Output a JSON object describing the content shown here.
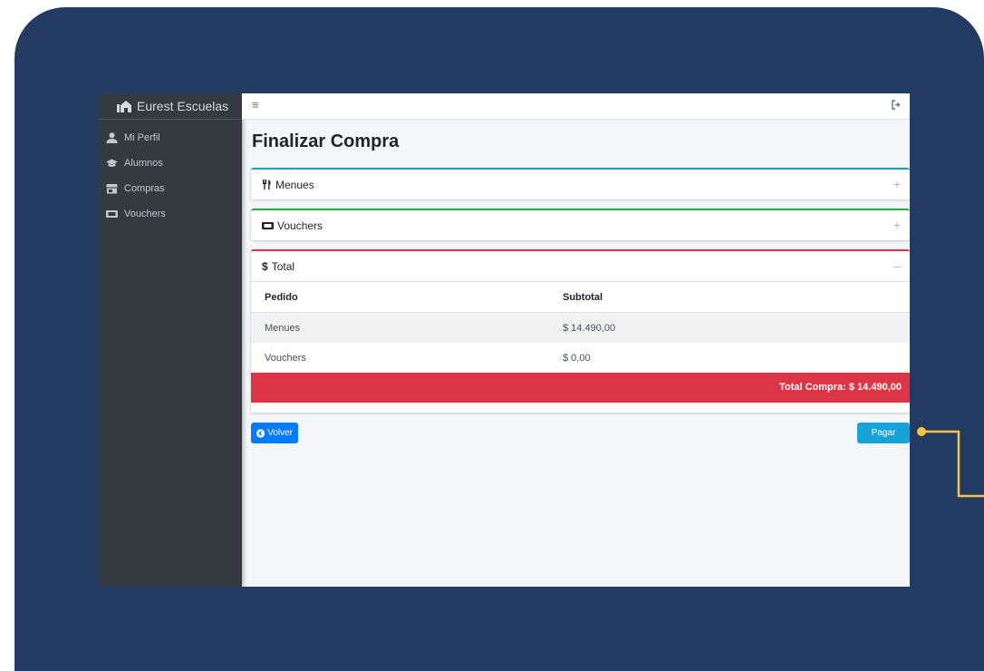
{
  "brand": {
    "name": "Eurest Escuelas"
  },
  "sidebar": {
    "items": [
      {
        "label": "Mi Perfil",
        "icon": "user-icon"
      },
      {
        "label": "Alumnos",
        "icon": "graduation-cap-icon"
      },
      {
        "label": "Compras",
        "icon": "store-icon"
      },
      {
        "label": "Vouchers",
        "icon": "ticket-icon"
      }
    ]
  },
  "topbar": {
    "menu_icon": "hamburger-icon",
    "logout_icon": "sign-out-icon"
  },
  "page": {
    "title": "Finalizar Compra"
  },
  "cards": {
    "menues": {
      "title": "Menues",
      "tool": "+"
    },
    "vouchers": {
      "title": "Vouchers",
      "tool": "+"
    },
    "total": {
      "title": "Total",
      "tool": "–",
      "icon_symbol": "$"
    }
  },
  "table": {
    "headers": [
      "Pedido",
      "Subtotal"
    ],
    "rows": [
      {
        "pedido": "Menues",
        "subtotal": "$ 14.490,00"
      },
      {
        "pedido": "Vouchers",
        "subtotal": "$ 0,00"
      }
    ],
    "total_label": "Total Compra: $ 14.490,00"
  },
  "actions": {
    "back": "Volver",
    "pay": "Pagar"
  },
  "colors": {
    "frame": "#233a63",
    "sidebar": "#343a40",
    "menues_accent": "#17a2b8",
    "vouchers_accent": "#28a745",
    "total_accent": "#dc3545",
    "primary": "#007bff",
    "callout": "#f6c343"
  }
}
